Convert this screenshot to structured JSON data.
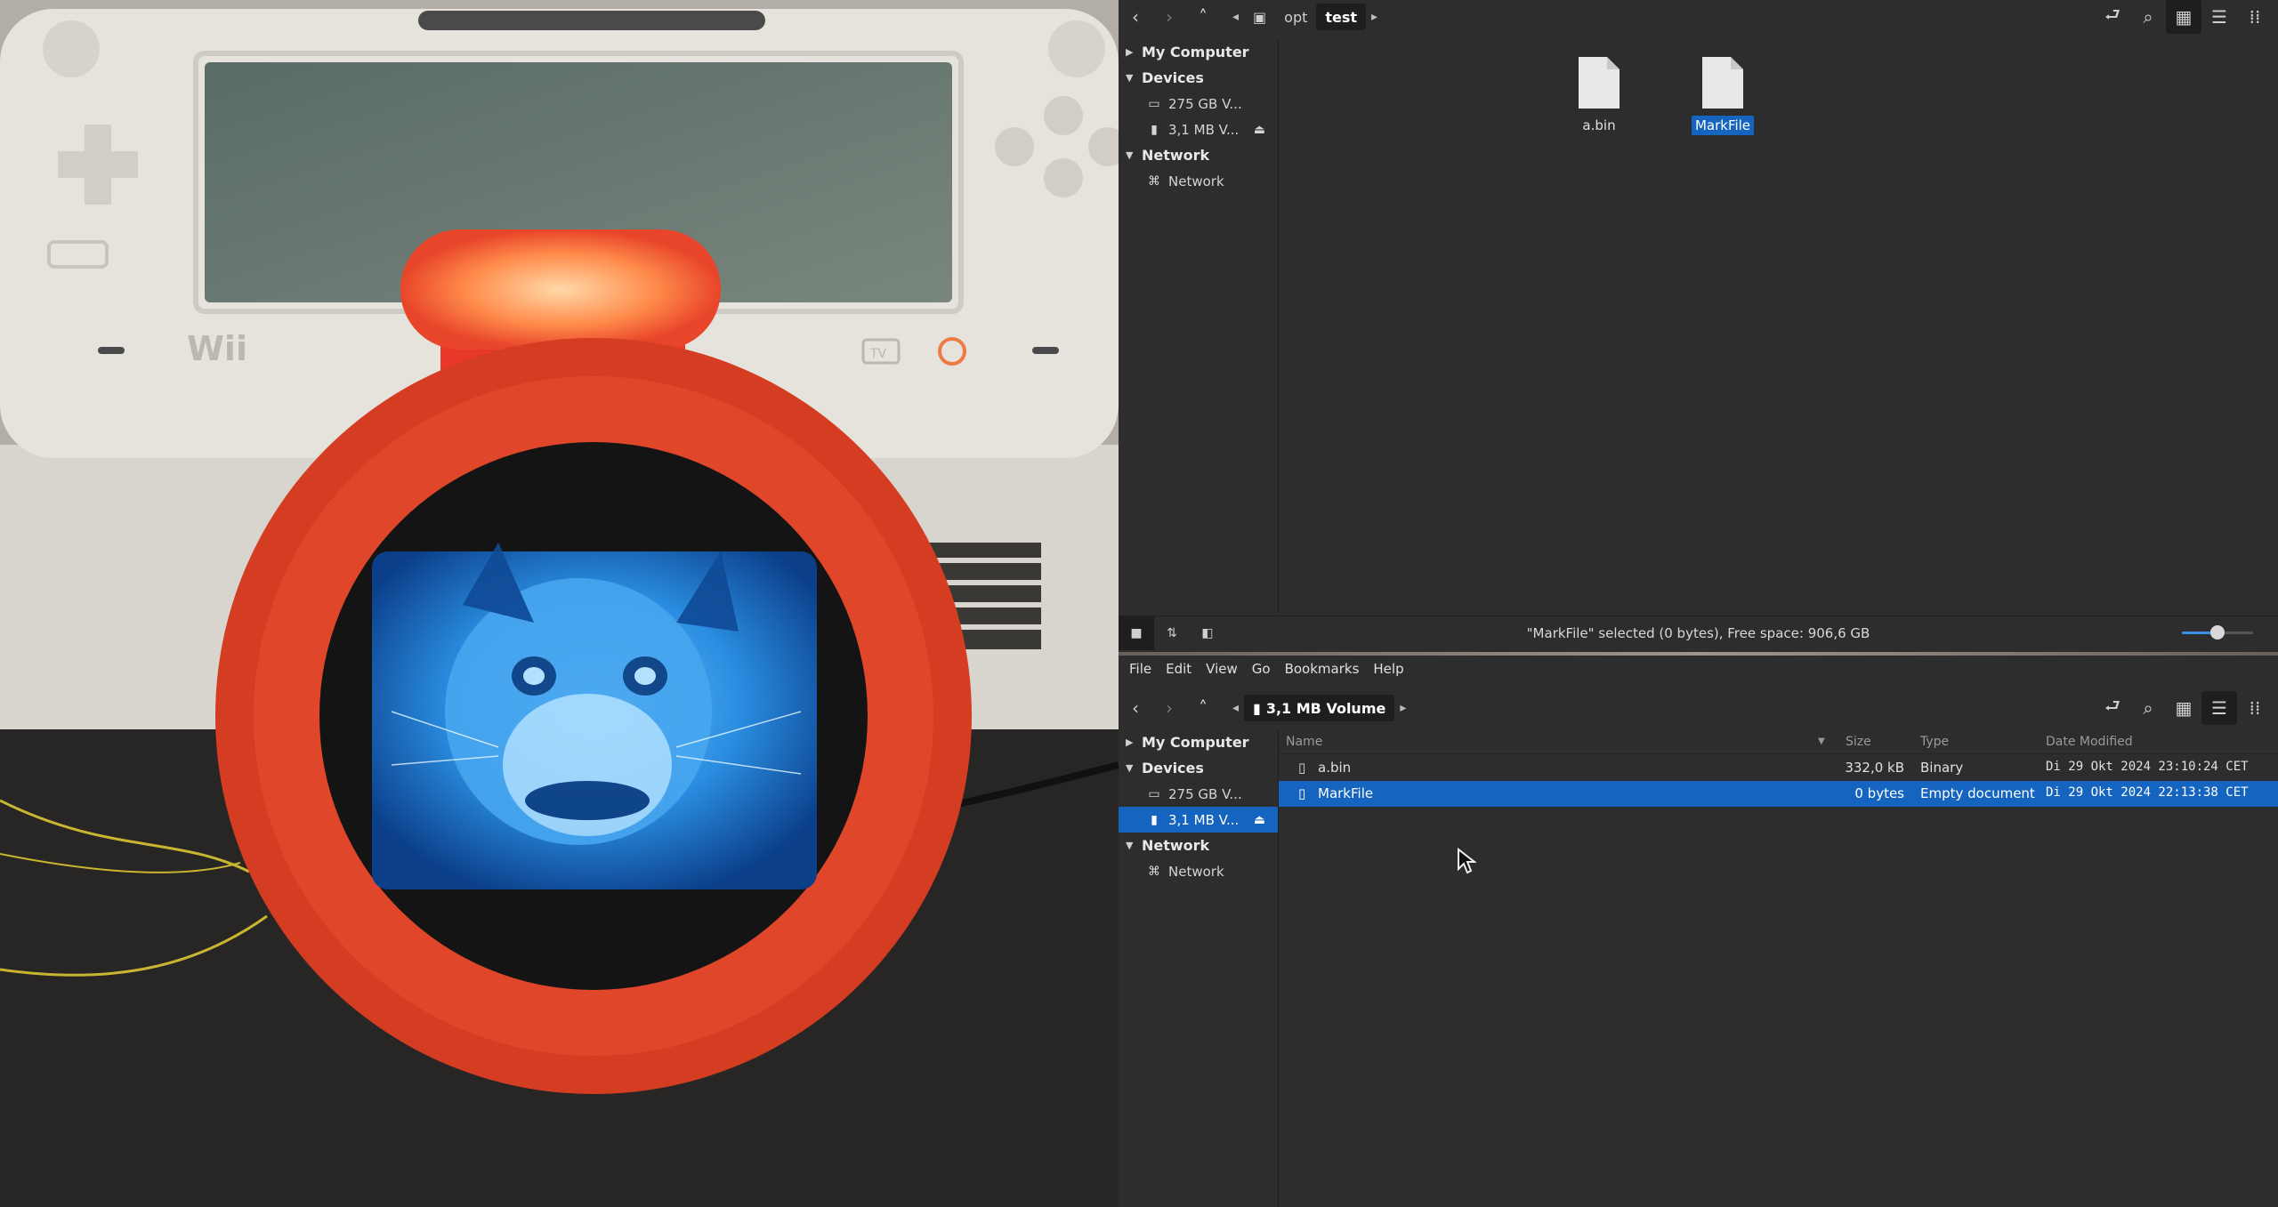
{
  "top_window": {
    "breadcrumb": {
      "segments": [
        "opt",
        "test"
      ],
      "active": "test"
    },
    "sidebar": {
      "my_computer": "My Computer",
      "devices": "Devices",
      "device_items": [
        "275 GB V...",
        "3,1 MB V..."
      ],
      "network_header": "Network",
      "network_item": "Network"
    },
    "files": [
      {
        "name": "a.bin",
        "selected": false
      },
      {
        "name": "MarkFile",
        "selected": true
      }
    ],
    "status": "\"MarkFile\" selected (0 bytes), Free space: 906,6 GB",
    "zoom_level": 0.5
  },
  "bottom_window": {
    "menus": [
      "File",
      "Edit",
      "View",
      "Go",
      "Bookmarks",
      "Help"
    ],
    "location": "3,1 MB Volume",
    "sidebar": {
      "my_computer": "My Computer",
      "devices": "Devices",
      "device_items": [
        "275 GB V...",
        "3,1 MB V..."
      ],
      "selected_device": "3,1 MB V...",
      "network_header": "Network",
      "network_item": "Network"
    },
    "columns": {
      "name": "Name",
      "size": "Size",
      "type": "Type",
      "date": "Date Modified"
    },
    "rows": [
      {
        "name": "a.bin",
        "size": "332,0 kB",
        "type": "Binary",
        "date": "Di 29 Okt 2024 23:10:24 CET",
        "selected": false
      },
      {
        "name": "MarkFile",
        "size": "0 bytes",
        "type": "Empty document",
        "date": "Di 29 Okt 2024 22:13:38 CET",
        "selected": true
      }
    ]
  },
  "photo": {
    "console_logo": "Wii",
    "tv_button": "TV"
  },
  "colors": {
    "selection": "#1565c0",
    "window_bg": "#2d2d2d"
  }
}
